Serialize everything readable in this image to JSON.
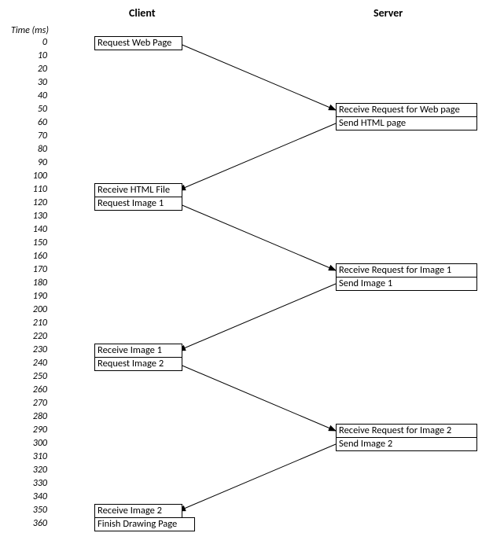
{
  "headers": {
    "time": "Time (ms)",
    "client": "Client",
    "server": "Server"
  },
  "time_ticks": [
    "0",
    "10",
    "20",
    "30",
    "40",
    "50",
    "60",
    "70",
    "80",
    "90",
    "100",
    "110",
    "120",
    "130",
    "140",
    "150",
    "160",
    "170",
    "180",
    "190",
    "200",
    "210",
    "220",
    "230",
    "240",
    "250",
    "260",
    "270",
    "280",
    "290",
    "300",
    "310",
    "320",
    "330",
    "340",
    "350",
    "360"
  ],
  "events": {
    "e0": "Request Web Page",
    "e1": "Receive Request for Web page",
    "e2": "Send HTML page",
    "e3": "Receive HTML File",
    "e4": "Request Image 1",
    "e5": "Receive Request for Image 1",
    "e6": "Send Image 1",
    "e7": "Receive Image 1",
    "e8": "Request Image 2",
    "e9": "Receive Request for Image 2",
    "e10": "Send Image 2",
    "e11": "Receive Image 2",
    "e12": "Finish Drawing Page"
  },
  "chart_data": {
    "type": "table",
    "title": "HTTP Client-Server Sequence Diagram",
    "columns": [
      "time_ms",
      "side",
      "event"
    ],
    "rows": [
      [
        0,
        "Client",
        "Request Web Page"
      ],
      [
        50,
        "Server",
        "Receive Request for Web page"
      ],
      [
        60,
        "Server",
        "Send HTML page"
      ],
      [
        110,
        "Client",
        "Receive HTML File"
      ],
      [
        120,
        "Client",
        "Request Image 1"
      ],
      [
        170,
        "Server",
        "Receive Request for Image 1"
      ],
      [
        180,
        "Server",
        "Send Image 1"
      ],
      [
        230,
        "Client",
        "Receive Image 1"
      ],
      [
        240,
        "Client",
        "Request Image 2"
      ],
      [
        290,
        "Server",
        "Receive Request for Image 2"
      ],
      [
        300,
        "Server",
        "Send Image 2"
      ],
      [
        350,
        "Client",
        "Receive Image 2"
      ],
      [
        360,
        "Client",
        "Finish Drawing Page"
      ]
    ],
    "arrows": [
      {
        "from_time": 0,
        "from_side": "Client",
        "to_time": 50,
        "to_side": "Server"
      },
      {
        "from_time": 60,
        "from_side": "Server",
        "to_time": 110,
        "to_side": "Client"
      },
      {
        "from_time": 120,
        "from_side": "Client",
        "to_time": 170,
        "to_side": "Server"
      },
      {
        "from_time": 180,
        "from_side": "Server",
        "to_time": 230,
        "to_side": "Client"
      },
      {
        "from_time": 240,
        "from_side": "Client",
        "to_time": 290,
        "to_side": "Server"
      },
      {
        "from_time": 300,
        "from_side": "Server",
        "to_time": 350,
        "to_side": "Client"
      }
    ]
  }
}
